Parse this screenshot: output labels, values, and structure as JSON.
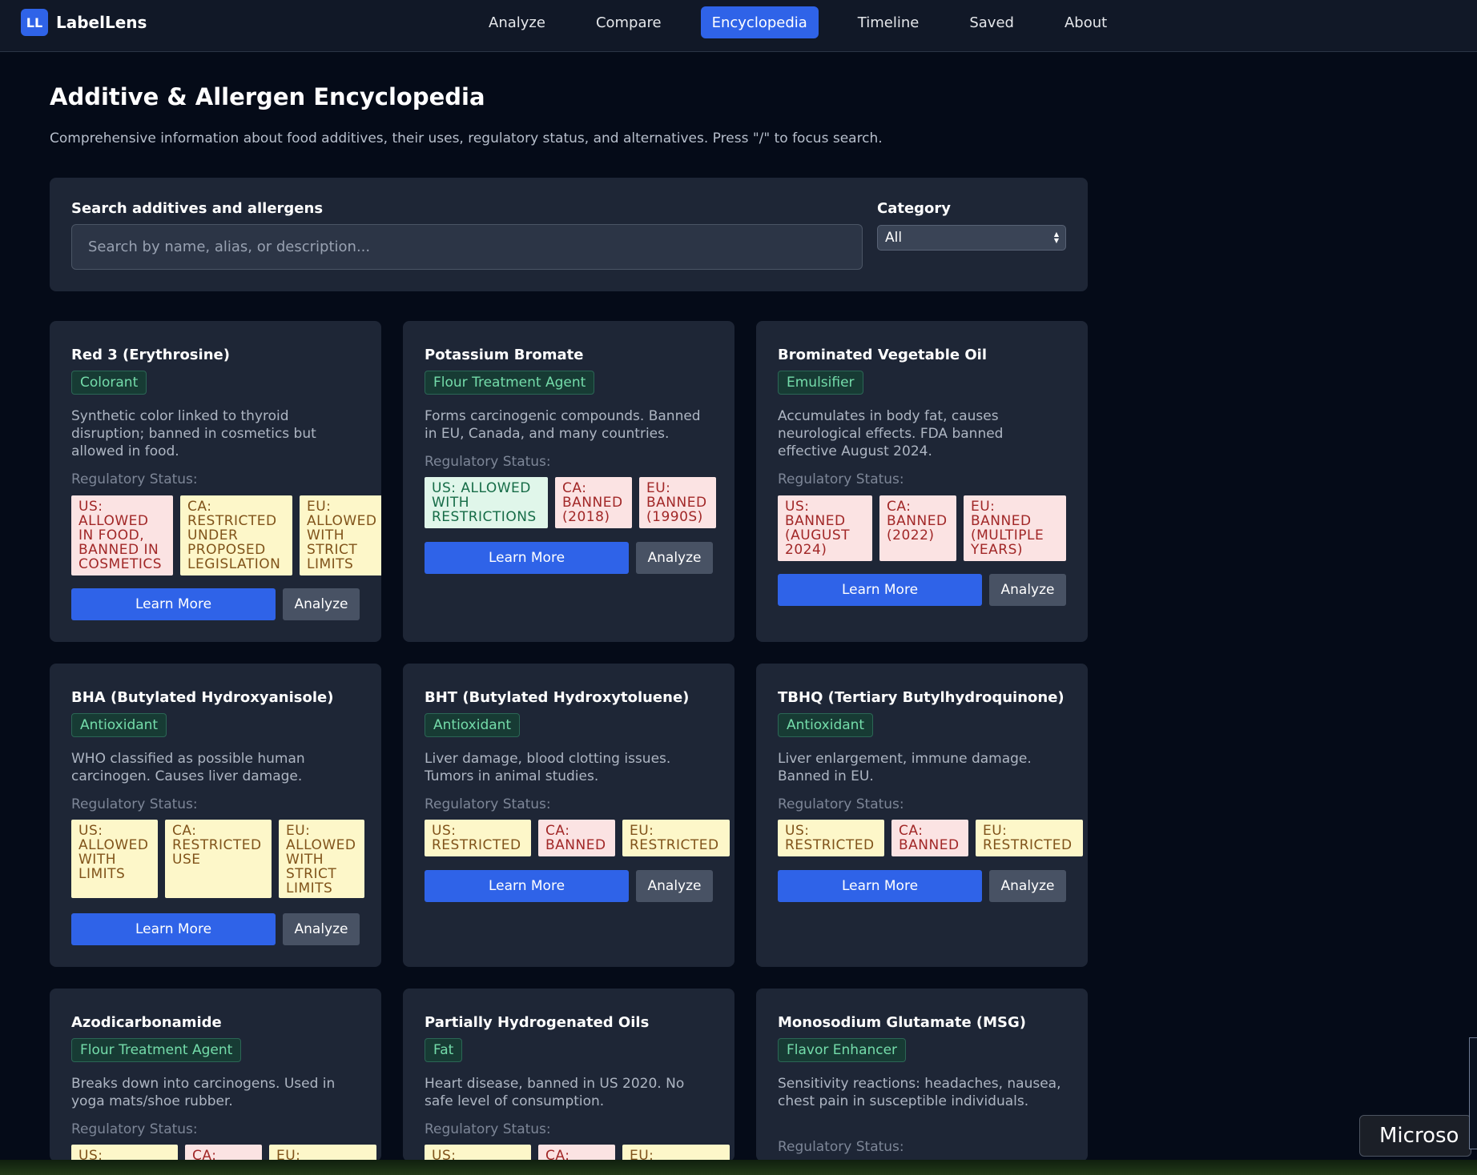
{
  "app": {
    "logo_badge": "LL",
    "name": "LabelLens"
  },
  "nav": [
    {
      "label": "Analyze",
      "active": false
    },
    {
      "label": "Compare",
      "active": false
    },
    {
      "label": "Encyclopedia",
      "active": true
    },
    {
      "label": "Timeline",
      "active": false
    },
    {
      "label": "Saved",
      "active": false
    },
    {
      "label": "About",
      "active": false
    }
  ],
  "page": {
    "title": "Additive & Allergen Encyclopedia",
    "subtitle": "Comprehensive information about food additives, their uses, regulatory status, and alternatives. Press \"/\" to focus search."
  },
  "search": {
    "label": "Search additives and allergens",
    "placeholder": "Search by name, alias, or description...",
    "value": "",
    "category_label": "Category",
    "category_value": "All"
  },
  "cards": [
    {
      "title": "Red 3 (Erythrosine)",
      "tag": "Colorant",
      "description": "Synthetic color linked to thyroid disruption; banned in cosmetics but allowed in food.",
      "regulatory_label": "Regulatory Status:",
      "statuses": [
        {
          "text": "US: ALLOWED IN FOOD, BANNED IN COSMETICS",
          "level": "red"
        },
        {
          "text": "CA: RESTRICTED UNDER PROPOSED LEGISLATION",
          "level": "yellow"
        },
        {
          "text": "EU: ALLOWED WITH STRICT LIMITS",
          "level": "yellow"
        }
      ],
      "learn_more": "Learn More",
      "analyze": "Analyze"
    },
    {
      "title": "Potassium Bromate",
      "tag": "Flour Treatment Agent",
      "description": "Forms carcinogenic compounds. Banned in EU, Canada, and many countries.",
      "regulatory_label": "Regulatory Status:",
      "statuses": [
        {
          "text": "US: ALLOWED WITH RESTRICTIONS",
          "level": "green"
        },
        {
          "text": "CA: BANNED (2018)",
          "level": "red"
        },
        {
          "text": "EU: BANNED (1990S)",
          "level": "red"
        }
      ],
      "learn_more": "Learn More",
      "analyze": "Analyze"
    },
    {
      "title": "Brominated Vegetable Oil",
      "tag": "Emulsifier",
      "description": "Accumulates in body fat, causes neurological effects. FDA banned effective August 2024.",
      "regulatory_label": "Regulatory Status:",
      "statuses": [
        {
          "text": "US: BANNED (AUGUST 2024)",
          "level": "red"
        },
        {
          "text": "CA: BANNED (2022)",
          "level": "red"
        },
        {
          "text": "EU: BANNED (MULTIPLE YEARS)",
          "level": "red"
        }
      ],
      "learn_more": "Learn More",
      "analyze": "Analyze"
    },
    {
      "title": "BHA (Butylated Hydroxyanisole)",
      "tag": "Antioxidant",
      "description": "WHO classified as possible human carcinogen. Causes liver damage.",
      "regulatory_label": "Regulatory Status:",
      "statuses": [
        {
          "text": "US: ALLOWED WITH LIMITS",
          "level": "yellow"
        },
        {
          "text": "CA: RESTRICTED USE",
          "level": "yellow"
        },
        {
          "text": "EU: ALLOWED WITH STRICT LIMITS",
          "level": "yellow"
        }
      ],
      "learn_more": "Learn More",
      "analyze": "Analyze"
    },
    {
      "title": "BHT (Butylated Hydroxytoluene)",
      "tag": "Antioxidant",
      "description": "Liver damage, blood clotting issues. Tumors in animal studies.",
      "regulatory_label": "Regulatory Status:",
      "statuses": [
        {
          "text": "US: RESTRICTED",
          "level": "yellow"
        },
        {
          "text": "CA: BANNED",
          "level": "red"
        },
        {
          "text": "EU: RESTRICTED",
          "level": "yellow"
        }
      ],
      "learn_more": "Learn More",
      "analyze": "Analyze"
    },
    {
      "title": "TBHQ (Tertiary Butylhydroquinone)",
      "tag": "Antioxidant",
      "description": "Liver enlargement, immune damage. Banned in EU.",
      "regulatory_label": "Regulatory Status:",
      "statuses": [
        {
          "text": "US: RESTRICTED",
          "level": "yellow"
        },
        {
          "text": "CA: BANNED",
          "level": "red"
        },
        {
          "text": "EU: RESTRICTED",
          "level": "yellow"
        }
      ],
      "learn_more": "Learn More",
      "analyze": "Analyze"
    },
    {
      "title": "Azodicarbonamide",
      "tag": "Flour Treatment Agent",
      "description": "Breaks down into carcinogens. Used in yoga mats/shoe rubber.",
      "regulatory_label": "Regulatory Status:",
      "statuses": [
        {
          "text": "US:",
          "level": "yellow"
        },
        {
          "text": "CA:",
          "level": "red"
        },
        {
          "text": "EU:",
          "level": "yellow"
        }
      ]
    },
    {
      "title": "Partially Hydrogenated Oils",
      "tag": "Fat",
      "description": "Heart disease, banned in US 2020. No safe level of consumption.",
      "regulatory_label": "Regulatory Status:",
      "statuses": [
        {
          "text": "US:",
          "level": "yellow"
        },
        {
          "text": "CA:",
          "level": "red"
        },
        {
          "text": "EU:",
          "level": "yellow"
        }
      ]
    },
    {
      "title": "Monosodium Glutamate (MSG)",
      "tag": "Flavor Enhancer",
      "description": "Sensitivity reactions: headaches, nausea, chest pain in susceptible individuals.",
      "regulatory_label": "Regulatory Status:",
      "statuses": []
    }
  ],
  "toast": {
    "text": "Microso"
  }
}
